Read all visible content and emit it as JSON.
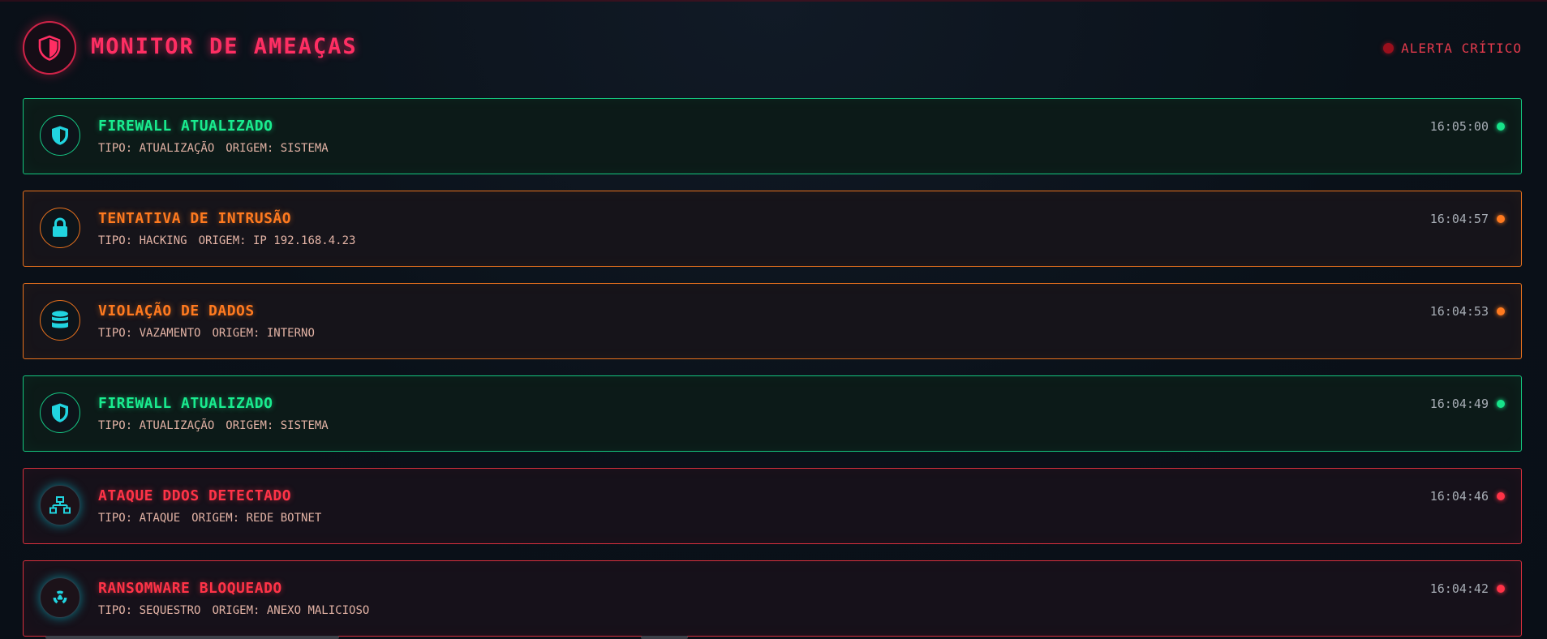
{
  "header": {
    "title": "MONITOR DE AMEAÇAS",
    "icon": "shield-half-icon",
    "alert_label": "ALERTA CRÍTICO",
    "alert_color": "#9a0f1c"
  },
  "colors": {
    "green": "#19ec8f",
    "orange": "#ff7a1f",
    "red": "#ff3347",
    "icon_cyan": "#21d4e0"
  },
  "events": [
    {
      "title": "FIREWALL ATUALIZADO",
      "tipo": "TIPO: ATUALIZAÇÃO",
      "origem": "ORIGEM: SISTEMA",
      "time": "16:05:00",
      "severity": "green",
      "icon": "shield-icon"
    },
    {
      "title": "TENTATIVA DE INTRUSÃO",
      "tipo": "TIPO: HACKING",
      "origem": "ORIGEM: IP 192.168.4.23",
      "time": "16:04:57",
      "severity": "orange",
      "icon": "lock-icon"
    },
    {
      "title": "VIOLAÇÃO DE DADOS",
      "tipo": "TIPO: VAZAMENTO",
      "origem": "ORIGEM: INTERNO",
      "time": "16:04:53",
      "severity": "orange",
      "icon": "database-icon"
    },
    {
      "title": "FIREWALL ATUALIZADO",
      "tipo": "TIPO: ATUALIZAÇÃO",
      "origem": "ORIGEM: SISTEMA",
      "time": "16:04:49",
      "severity": "green",
      "icon": "shield-icon"
    },
    {
      "title": "ATAQUE DDOS DETECTADO",
      "tipo": "TIPO: ATAQUE",
      "origem": "ORIGEM: REDE BOTNET",
      "time": "16:04:46",
      "severity": "red",
      "icon": "network-icon"
    },
    {
      "title": "RANSOMWARE BLOQUEADO",
      "tipo": "TIPO: SEQUESTRO",
      "origem": "ORIGEM: ANEXO MALICIOSO",
      "time": "16:04:42",
      "severity": "red",
      "icon": "radiation-icon"
    }
  ]
}
